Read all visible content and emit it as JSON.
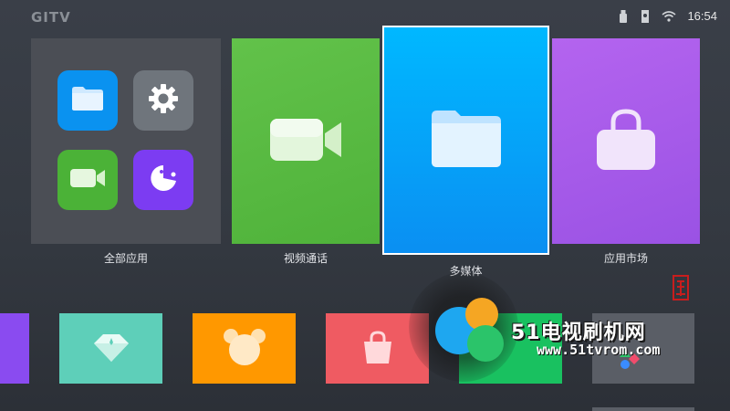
{
  "header": {
    "logo": "GITV",
    "clock": "16:54",
    "icons": [
      "usb-icon",
      "sd-card-icon",
      "wifi-icon"
    ]
  },
  "main_tiles": [
    {
      "label": "全部应用",
      "icon": "app-grid-icon"
    },
    {
      "label": "视频通话",
      "icon": "video-camera-icon"
    },
    {
      "label": "多媒体",
      "icon": "folder-icon",
      "focused": true
    },
    {
      "label": "应用市场",
      "icon": "shopping-bag-icon"
    }
  ],
  "all_apps_minis": [
    "folder-icon",
    "settings-icon",
    "video-camera-icon",
    "game-pacman-icon"
  ],
  "bottom_tiles": [
    "purple-partial",
    "crown-icon",
    "bear-icon",
    "shopping-bag-icon",
    "green-app",
    "gray-app"
  ],
  "watermark": {
    "title": "51电视刷机网",
    "url": "www.51tvrom.com"
  },
  "colors": {
    "video": "#5bbd44",
    "media": "#0aa6fb",
    "market": "#a85ceb",
    "allapps": "#4b4e55"
  }
}
